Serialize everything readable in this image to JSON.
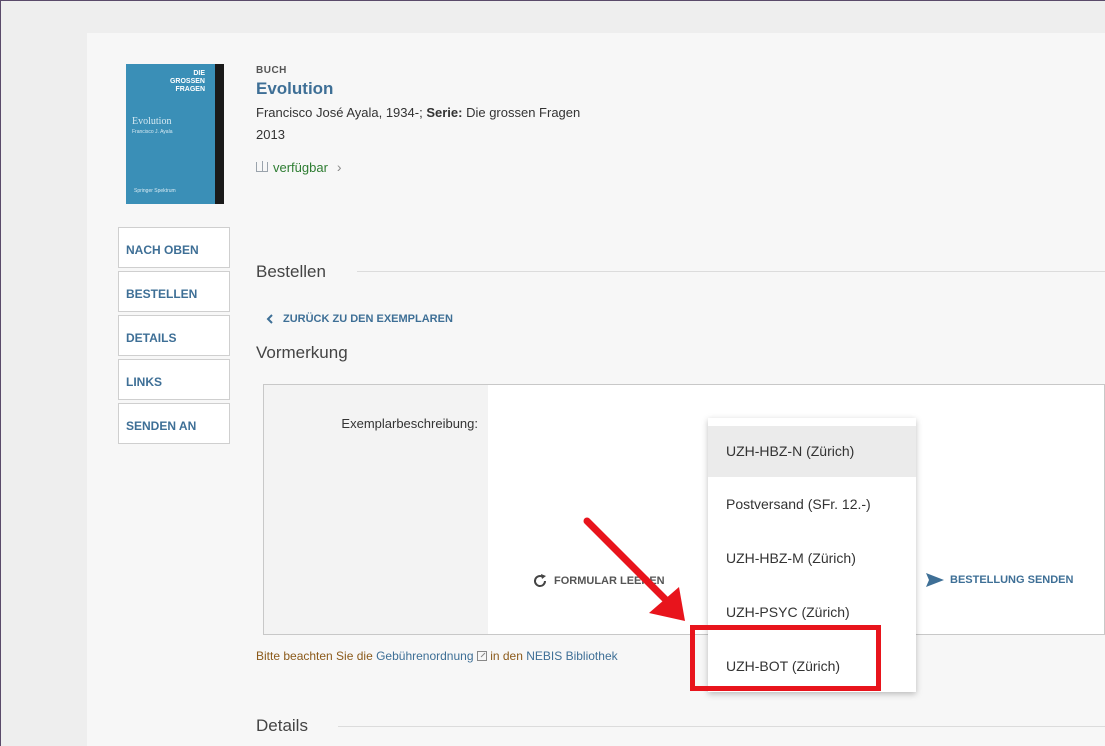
{
  "record": {
    "type_label": "BUCH",
    "title": "Evolution",
    "author": "Francisco José Ayala, 1934-;",
    "series_label": "Serie:",
    "series_value": "Die grossen Fragen",
    "year": "2013",
    "availability": "verfügbar",
    "cover": {
      "line1": "DIE",
      "line2": "GROSSEN",
      "line3": "FRAGEN",
      "title": "Evolution",
      "subtitle": "Francisco J. Ayala",
      "publisher": "Springer Spektrum"
    }
  },
  "side_nav": {
    "items": [
      {
        "label": "NACH OBEN"
      },
      {
        "label": "BESTELLEN"
      },
      {
        "label": "DETAILS"
      },
      {
        "label": "LINKS"
      },
      {
        "label": "SENDEN AN"
      }
    ]
  },
  "sections": {
    "bestellen": "Bestellen",
    "vormerkung": "Vormerkung",
    "details": "Details"
  },
  "back_link": "ZURÜCK ZU DEN EXEMPLAREN",
  "form": {
    "field_label": "Exemplarbeschreibung:",
    "clear_label": "FORMULAR LEEREN",
    "send_label": "BESTELLUNG SENDEN"
  },
  "notice": {
    "prefix": "Bitte beachten Sie die ",
    "link1": "Gebührenordnung",
    "mid": " in den ",
    "link2": "NEBIS Bibliothek"
  },
  "dropdown": {
    "options": [
      {
        "label": "UZH-HBZ-N (Zürich)"
      },
      {
        "label": "Postversand (SFr. 12.-)"
      },
      {
        "label": "UZH-HBZ-M (Zürich)"
      },
      {
        "label": "UZH-PSYC (Zürich)"
      },
      {
        "label": "UZH-BOT (Zürich)"
      }
    ]
  },
  "colors": {
    "link": "#3e6f96",
    "available": "#2e7d32",
    "notice": "#8b5a1a",
    "highlight": "#e8141c"
  }
}
